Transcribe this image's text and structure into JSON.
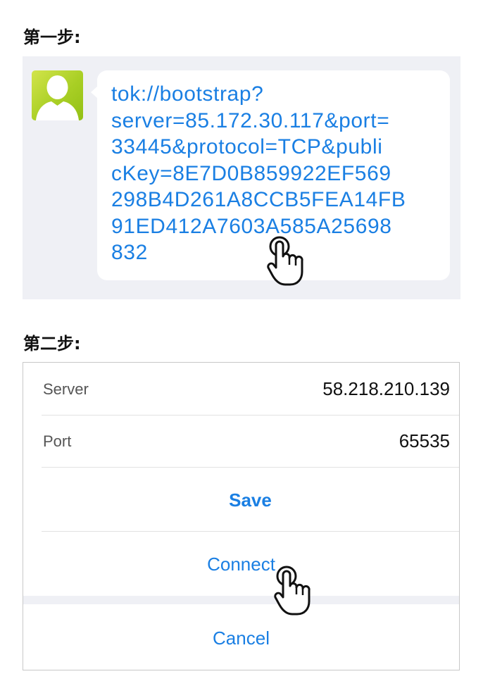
{
  "step1": {
    "title": "第一步:",
    "message_link": "tok://bootstrap?\nserver=85.172.30.117&port=\n33445&protocol=TCP&publi\ncKey=8E7D0B859922EF569\n298B4D261A8CCB5FEA14FB\n91ED412A7603A585A25698\n832"
  },
  "step2": {
    "title": "第二步:",
    "server": {
      "label": "Server",
      "value": "58.218.210.139"
    },
    "port": {
      "label": "Port",
      "value": "65535"
    },
    "save_label": "Save",
    "connect_label": "Connect",
    "cancel_label": "Cancel"
  },
  "icons": {
    "avatar": "default-user-avatar-icon",
    "pointer": "tap-hand-icon"
  },
  "colors": {
    "link_blue": "#1a7fe3",
    "panel_gray": "#eff0f5",
    "avatar_green": "#a9cf25"
  }
}
